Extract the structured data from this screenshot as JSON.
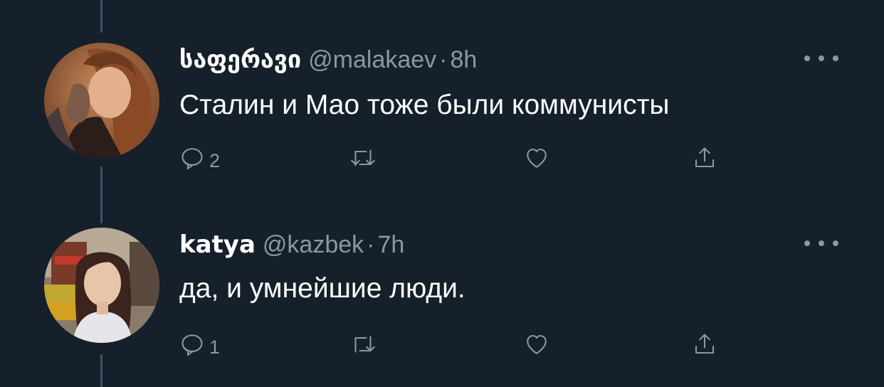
{
  "colors": {
    "background": "#15202b",
    "thread_line": "#3d5466",
    "secondary_text": "#8899a6",
    "primary_text": "#ffffff"
  },
  "tweets": [
    {
      "display_name": "საფერავი",
      "handle": "@malakaev",
      "separator": "·",
      "time": "8h",
      "text": "Сталин и Мао тоже были коммунисты",
      "reply_count": "2",
      "icons": [
        "reply-icon",
        "retweet-icon",
        "like-icon",
        "share-icon",
        "more-icon"
      ]
    },
    {
      "display_name": "katya",
      "handle": "@kazbek",
      "separator": "·",
      "time": "7h",
      "text": "да, и умнейшие люди.",
      "reply_count": "1",
      "icons": [
        "reply-icon",
        "retweet-icon",
        "like-icon",
        "share-icon",
        "more-icon"
      ]
    }
  ]
}
